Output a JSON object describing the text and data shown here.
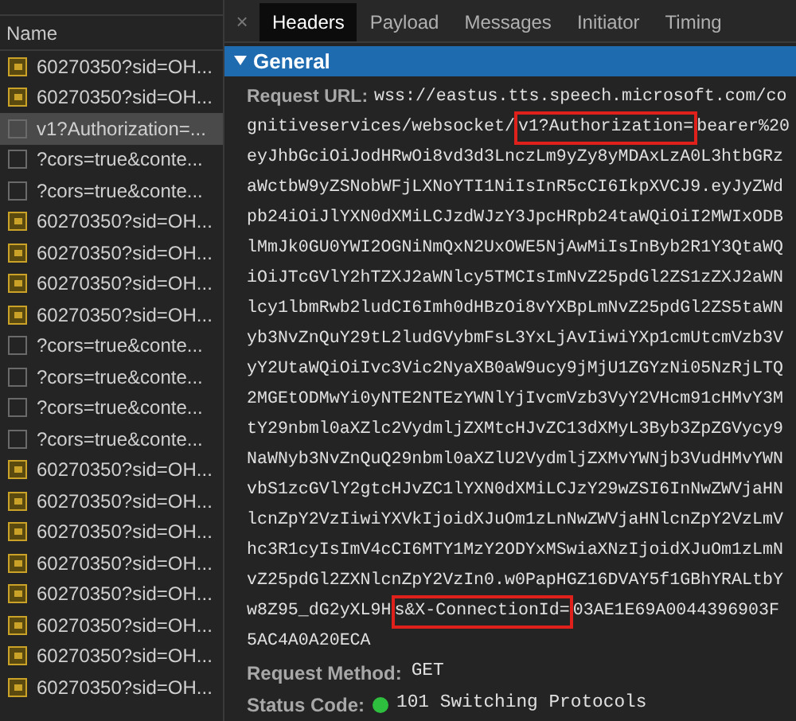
{
  "sidebar": {
    "header": "Name",
    "items": [
      {
        "label": "60270350?sid=OH...",
        "kind": "socket",
        "selected": false
      },
      {
        "label": "60270350?sid=OH...",
        "kind": "socket",
        "selected": false
      },
      {
        "label": "v1?Authorization=...",
        "kind": "plain",
        "selected": true
      },
      {
        "label": "?cors=true&conte...",
        "kind": "plain",
        "selected": false
      },
      {
        "label": "?cors=true&conte...",
        "kind": "plain",
        "selected": false
      },
      {
        "label": "60270350?sid=OH...",
        "kind": "socket",
        "selected": false
      },
      {
        "label": "60270350?sid=OH...",
        "kind": "socket",
        "selected": false
      },
      {
        "label": "60270350?sid=OH...",
        "kind": "socket",
        "selected": false
      },
      {
        "label": "60270350?sid=OH...",
        "kind": "socket",
        "selected": false
      },
      {
        "label": "?cors=true&conte...",
        "kind": "plain",
        "selected": false
      },
      {
        "label": "?cors=true&conte...",
        "kind": "plain",
        "selected": false
      },
      {
        "label": "?cors=true&conte...",
        "kind": "plain",
        "selected": false
      },
      {
        "label": "?cors=true&conte...",
        "kind": "plain",
        "selected": false
      },
      {
        "label": "60270350?sid=OH...",
        "kind": "socket",
        "selected": false
      },
      {
        "label": "60270350?sid=OH...",
        "kind": "socket",
        "selected": false
      },
      {
        "label": "60270350?sid=OH...",
        "kind": "socket",
        "selected": false
      },
      {
        "label": "60270350?sid=OH...",
        "kind": "socket",
        "selected": false
      },
      {
        "label": "60270350?sid=OH...",
        "kind": "socket",
        "selected": false
      },
      {
        "label": "60270350?sid=OH...",
        "kind": "socket",
        "selected": false
      },
      {
        "label": "60270350?sid=OH...",
        "kind": "socket",
        "selected": false
      },
      {
        "label": "60270350?sid=OH...",
        "kind": "socket",
        "selected": false
      }
    ]
  },
  "tabs": {
    "close": "×",
    "items": [
      {
        "label": "Headers",
        "selected": true
      },
      {
        "label": "Payload",
        "selected": false
      },
      {
        "label": "Messages",
        "selected": false
      },
      {
        "label": "Initiator",
        "selected": false
      },
      {
        "label": "Timing",
        "selected": false
      }
    ]
  },
  "section": {
    "title": "General",
    "expanded": true,
    "request_url": {
      "label": "Request URL:",
      "lines": [
        [
          {
            "text": "wss://eastus.tts.speech.microsoft.com/co",
            "highlighted": false
          }
        ],
        [
          {
            "text": "gnitiveservices/websocket/",
            "highlighted": false
          },
          {
            "text": "v1?Authorization=",
            "highlighted": true
          },
          {
            "text": "bearer%20",
            "highlighted": false
          }
        ],
        [
          {
            "text": "eyJhbGciOiJodHRwOi8vd3d3LnczLm9yZy8yMDAxLzA0L3htbGRz",
            "highlighted": false
          }
        ],
        [
          {
            "text": "aWctbW9yZSNobWFjLXNoYTI1NiIsInR5cCI6IkpXVCJ9.eyJyZWd",
            "highlighted": false
          }
        ],
        [
          {
            "text": "pb24iOiJlYXN0dXMiLCJzdWJzY3JpcHRpb24taWQiOiI2MWIxODB",
            "highlighted": false
          }
        ],
        [
          {
            "text": "lMmJk0GU0YWI2OGNiNmQxN2UxOWE5NjAwMiIsInByb2R1Y3QtaWQ",
            "highlighted": false
          }
        ],
        [
          {
            "text": "iOiJTcGVlY2hTZXJ2aWNlcy5TMCIsImNvZ25pdGl2ZS1zZXJ2aWN",
            "highlighted": false
          }
        ],
        [
          {
            "text": "lcy1lbmRwb2ludCI6Imh0dHBzOi8vYXBpLmNvZ25pdGl2ZS5taWN",
            "highlighted": false
          }
        ],
        [
          {
            "text": "yb3NvZnQuY29tL2ludGVybmFsL3YxLjAvIiwiYXp1cmUtcmVzb3V",
            "highlighted": false
          }
        ],
        [
          {
            "text": "yY2UtaWQiOiIvc3Vic2NyaXB0aW9ucy9jMjU1ZGYzNi05NzRjLTQ",
            "highlighted": false
          }
        ],
        [
          {
            "text": "2MGEtODMwYi0yNTE2NTEzYWNlYjIvcmVzb3VyY2VHcm91cHMvY3M",
            "highlighted": false
          }
        ],
        [
          {
            "text": "tY29nbml0aXZlc2VydmljZXMtcHJvZC13dXMyL3Byb3ZpZGVycy9",
            "highlighted": false
          }
        ],
        [
          {
            "text": "NaWNyb3NvZnQuQ29nbml0aXZlU2VydmljZXMvYWNjb3VudHMvYWN",
            "highlighted": false
          }
        ],
        [
          {
            "text": "vbS1zcGVlY2gtcHJvZC1lYXN0dXMiLCJzY29wZSI6InNwZWVjaHN",
            "highlighted": false
          }
        ],
        [
          {
            "text": "lcnZpY2VzIiwiYXVkIjoidXJuOm1zLnNwZWVjaHNlcnZpY2VzLmV",
            "highlighted": false
          }
        ],
        [
          {
            "text": "hc3R1cyIsImV4cCI6MTY1MzY2ODYxMSwiaXNzIjoidXJuOm1zLmN",
            "highlighted": false
          }
        ],
        [
          {
            "text": "vZ25pdGl2ZXNlcnZpY2VzIn0.w0PapHGZ16DVAY5f1GBhYRALtbY",
            "highlighted": false
          }
        ],
        [
          {
            "text": "w8Z95_dG2yXL9H",
            "highlighted": false
          },
          {
            "text": "s&X-ConnectionId=",
            "highlighted": true
          },
          {
            "text": "03AE1E69A0044396903F",
            "highlighted": false
          }
        ],
        [
          {
            "text": "5AC4A0A20ECA",
            "highlighted": false
          }
        ]
      ]
    },
    "request_method": {
      "label": "Request Method:",
      "value": "GET"
    },
    "status_code": {
      "label": "Status Code:",
      "value": "101 Switching Protocols",
      "color": "#2fbf3f"
    }
  }
}
